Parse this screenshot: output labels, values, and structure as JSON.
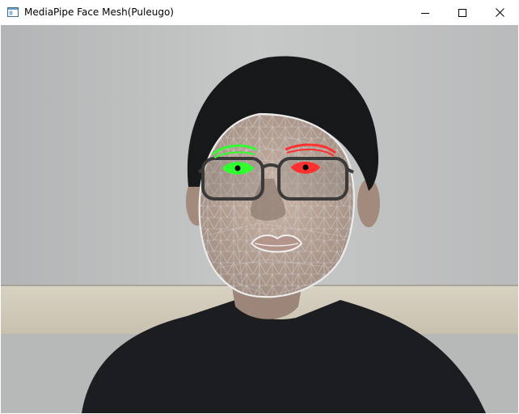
{
  "window": {
    "title": "MediaPipe Face Mesh(Puleugo)",
    "app_icon": "app-window-icon",
    "controls": [
      "minimize-icon",
      "maximize-icon",
      "close-icon"
    ]
  },
  "video": {
    "subject": "person-with-glasses",
    "overlay": "face-mesh-tesselation",
    "colors": {
      "mesh": "#c8c8c8",
      "contour": "#e6e6e6",
      "left_eye": "#30ff30",
      "right_eye": "#ff3030",
      "iris": "#000000"
    }
  }
}
